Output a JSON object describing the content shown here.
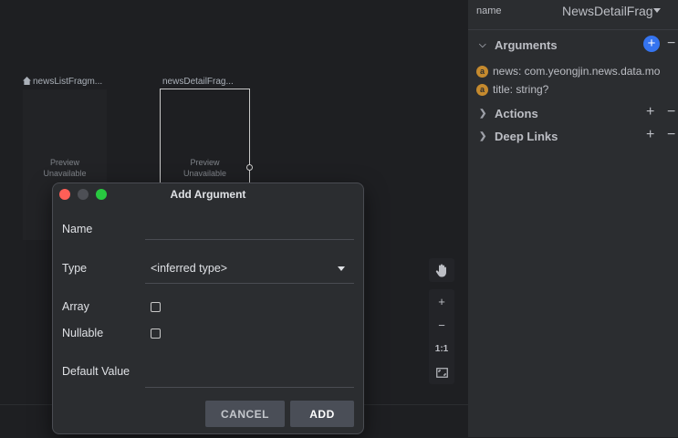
{
  "canvas": {
    "fragments": [
      {
        "title": "newsListFragm...",
        "preview": [
          "Preview",
          "Unavailable"
        ],
        "is_start": true
      },
      {
        "title": "newsDetailFrag...",
        "preview": [
          "Preview",
          "Unavailable"
        ],
        "is_start": false
      }
    ],
    "tools": {
      "pan": "pan-hand",
      "zoom_in": "+",
      "zoom_out": "−",
      "actual_size": "1:1",
      "fit": "fit-screen"
    }
  },
  "panel": {
    "name_label": "name",
    "name_value": "NewsDetailFrag",
    "sections": {
      "arguments": "Arguments",
      "actions": "Actions",
      "deep_links": "Deep Links"
    },
    "arguments": [
      {
        "badge": "a",
        "text": "news: com.yeongjin.news.data.mo"
      },
      {
        "badge": "a",
        "text": "title: string?"
      }
    ],
    "plus": "+",
    "minus": "−"
  },
  "dialog": {
    "title": "Add Argument",
    "fields": {
      "name_label": "Name",
      "name_value": "",
      "type_label": "Type",
      "type_value": "<inferred type>",
      "array_label": "Array",
      "nullable_label": "Nullable",
      "default_label": "Default Value",
      "default_value": ""
    },
    "buttons": {
      "cancel": "CANCEL",
      "add": "ADD"
    },
    "colors": {
      "close": "#ff5f57",
      "minimize": "#4d4f55",
      "zoom": "#28c840"
    }
  }
}
